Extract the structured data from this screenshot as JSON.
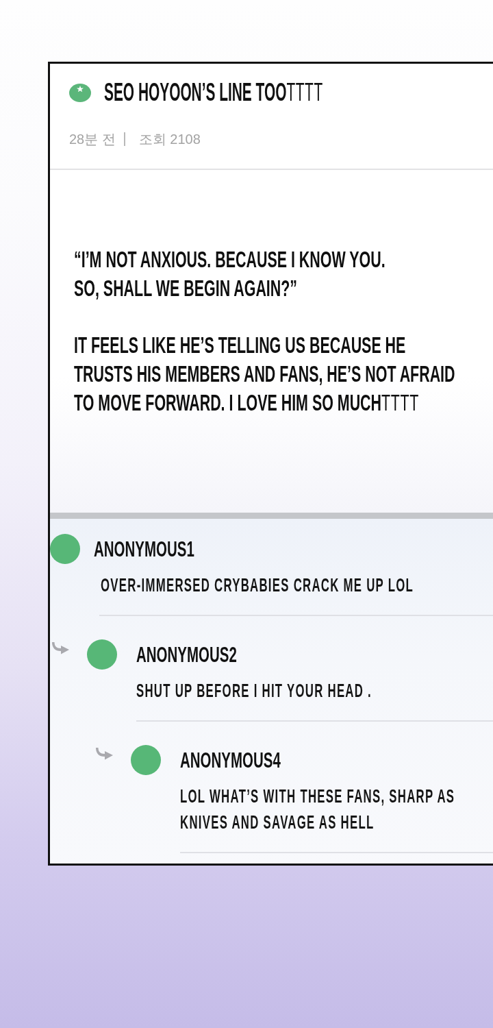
{
  "post": {
    "title": "**SEO HOYOON’S LINE TOO**TTTT",
    "time": "28분 전",
    "views": "조회 2108",
    "paragraphs": [
      "“I’M NOT ANXIOUS. BECAUSE I KNOW YOU.\nSO, SHALL WE BEGIN AGAIN?”",
      "**IT FEELS LIKE HE’S TELLING US BECAUSE HE TRUSTS HIS MEMBERS AND FANS, HE’S NOT AFRAID TO MOVE FORWARD. I LOVE HIM SO MUCH**TTTT"
    ]
  },
  "comments": [
    {
      "author": "ANONYMOUS1",
      "text": "OVER-IMMERSED CRYBABIES CRACK ME UP LOL",
      "children": [
        {
          "author": "ANONYMOUS2",
          "text": "SHUT UP BEFORE I HIT YOUR HEAD .",
          "children": [
            {
              "author": "ANONYMOUS4",
              "text": "LOL WHAT’S WITH THESE FANS, SHARP AS KNIVES AND SAVAGE AS HELL"
            }
          ]
        }
      ]
    }
  ]
}
